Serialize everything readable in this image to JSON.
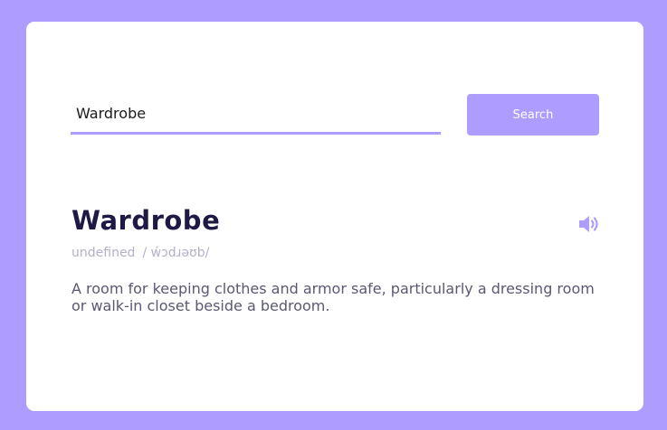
{
  "search": {
    "value": "Wardrobe",
    "button_label": "Search"
  },
  "entry": {
    "word": "Wardrobe",
    "part_of_speech": "undefined",
    "phonetic": "/ ẃɔdɹəʊb/",
    "definition": "A room for keeping clothes and armor safe, particularly a dressing room or walk-in closet beside a bedroom."
  },
  "icons": {
    "audio": "speaker-icon"
  },
  "colors": {
    "background": "#ae9cff",
    "accent": "#ae9cff",
    "card": "#ffffff",
    "word": "#1f1946",
    "muted": "#b4b0c8",
    "definition": "#5a5872"
  }
}
